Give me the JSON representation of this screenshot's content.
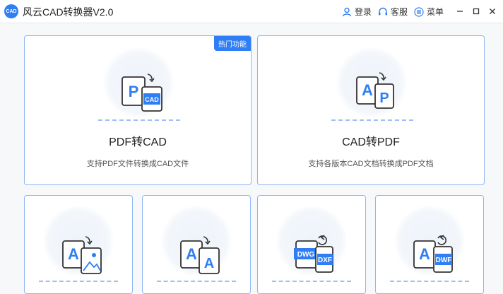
{
  "app": {
    "title": "风云CAD转换器V2.0",
    "logo_text": "CAD"
  },
  "titlebar": {
    "login_label": "登录",
    "service_label": "客服",
    "menu_label": "菜单"
  },
  "cards": [
    {
      "title": "PDF转CAD",
      "desc": "支持PDF文件转换成CAD文件",
      "badge": "热门功能",
      "icon": "pdf-to-cad-icon"
    },
    {
      "title": "CAD转PDF",
      "desc": "支持各版本CAD文档转换成PDF文档",
      "icon": "cad-to-pdf-icon"
    },
    {
      "icon": "cad-to-image-icon"
    },
    {
      "icon": "cad-to-a-icon"
    },
    {
      "icon": "dwg-to-dxf-icon"
    },
    {
      "icon": "cad-to-dwf-icon"
    }
  ],
  "icon_text": {
    "p": "P",
    "cad": "CAD",
    "a": "A",
    "dwg": "DWG",
    "dxf": "DXF",
    "dwf": "DWF"
  },
  "colors": {
    "accent": "#2f7ef5",
    "card_border": "#8fb6f3"
  }
}
